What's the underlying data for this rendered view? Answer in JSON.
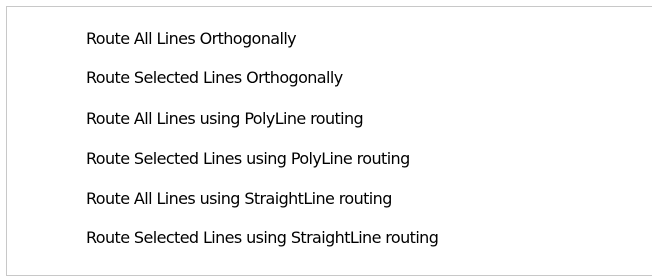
{
  "menu": {
    "items": [
      {
        "label": "Route All Lines Orthogonally"
      },
      {
        "label": "Route Selected Lines Orthogonally"
      },
      {
        "label": "Route All Lines using PolyLine routing"
      },
      {
        "label": "Route Selected Lines using PolyLine routing"
      },
      {
        "label": "Route All Lines using StraightLine routing"
      },
      {
        "label": "Route Selected Lines using StraightLine routing"
      }
    ]
  }
}
